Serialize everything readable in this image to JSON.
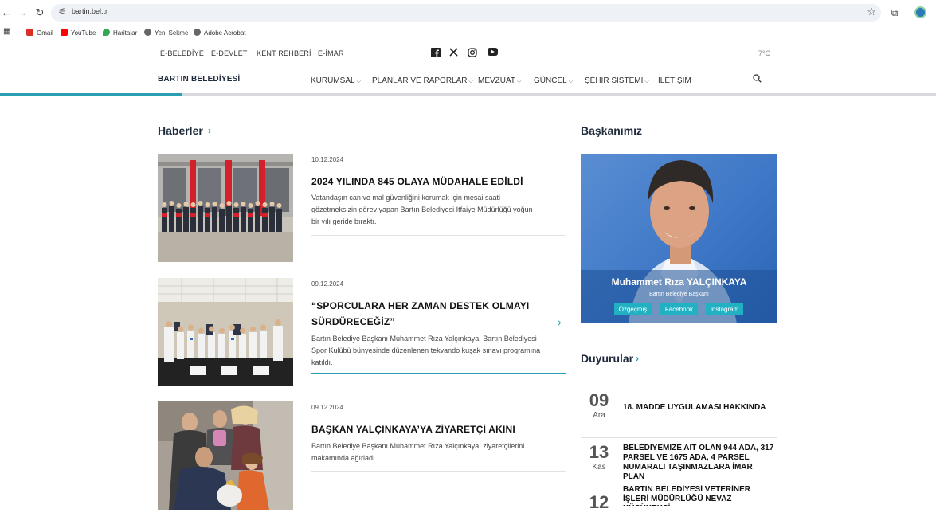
{
  "browser": {
    "url": "bartin.bel.tr",
    "bookmarks": [
      {
        "label": "Gmail",
        "color": "#d93025"
      },
      {
        "label": "YouTube",
        "color": "#ff0000"
      },
      {
        "label": "Haritalar",
        "color": "#34a853"
      },
      {
        "label": "Yeni Sekme",
        "color": "#666666"
      },
      {
        "label": "Adobe Acrobat",
        "color": "#666666"
      }
    ]
  },
  "site": {
    "top_links": [
      "E-BELEDİYE",
      "E-DEVLET",
      "KENT REHBERİ",
      "E-İMAR"
    ],
    "temperature": "7°C",
    "logo": "BARTIN BELEDİYESİ",
    "menu": [
      {
        "label": "KURUMSAL",
        "dropdown": true
      },
      {
        "label": "PLANLAR VE RAPORLAR",
        "dropdown": true
      },
      {
        "label": "MEVZUAT",
        "dropdown": true
      },
      {
        "label": "GÜNCEL",
        "dropdown": true
      },
      {
        "label": "ŞEHİR SİSTEMİ",
        "dropdown": true
      },
      {
        "label": "İLETİŞİM",
        "dropdown": false
      }
    ]
  },
  "news": {
    "title": "Haberler",
    "items": [
      {
        "date": "10.12.2024",
        "title": "2024 YILINDA 845 OLAYA MÜDAHALE EDİLDİ",
        "desc": "Vatandaşın can ve mal güvenliğini korumak için mesai saati gözetmeksizin görev yapan Bartın Belediyesi İtfaiye Müdürlüğü yoğun bir yılı geride bıraktı."
      },
      {
        "date": "09.12.2024",
        "title": "“SPORCULARA HER ZAMAN DESTEK OLMAYI SÜRDÜRECEĞİZ”",
        "desc": "Bartın Belediye Başkanı Muhammet Rıza Yalçınkaya, Bartın Belediyesi Spor Kulübü bünyesinde düzenlenen tekvando kuşak sınavı programına katıldı."
      },
      {
        "date": "09.12.2024",
        "title": "BAŞKAN YALÇINKAYA’YA ZİYARETÇİ AKINI",
        "desc": "Bartın Belediye Başkanı Muhammet Rıza Yalçınkaya, ziyaretçilerini makamında ağırladı."
      }
    ]
  },
  "mayor": {
    "section_title": "Başkanımız",
    "name": "Muhammet Rıza YALÇINKAYA",
    "role": "Bartın Belediye Başkanı",
    "buttons": [
      "Özgeçmiş",
      "Facebook",
      "Instagram"
    ]
  },
  "announcements": {
    "title": "Duyurular",
    "items": [
      {
        "day": "09",
        "month": "Ara",
        "text": "18. MADDE UYGULAMASI HAKKINDA"
      },
      {
        "day": "13",
        "month": "Kas",
        "text": "BELEDİYEMİZE AİT OLAN 944 ADA, 317 PARSEL VE 1675 ADA, 4 PARSEL NUMARALI TAŞINMAZLARA İMAR PLAN"
      },
      {
        "day": "12",
        "month": "",
        "text": "BARTIN BELEDİYESİ VETERİNER İŞLERİ MÜDÜRLÜĞÜ NEVAZ KÜÇÜKEKŞİ"
      }
    ]
  },
  "colors": {
    "accent": "#2a9fb3",
    "dark": "#1e2a3b"
  }
}
